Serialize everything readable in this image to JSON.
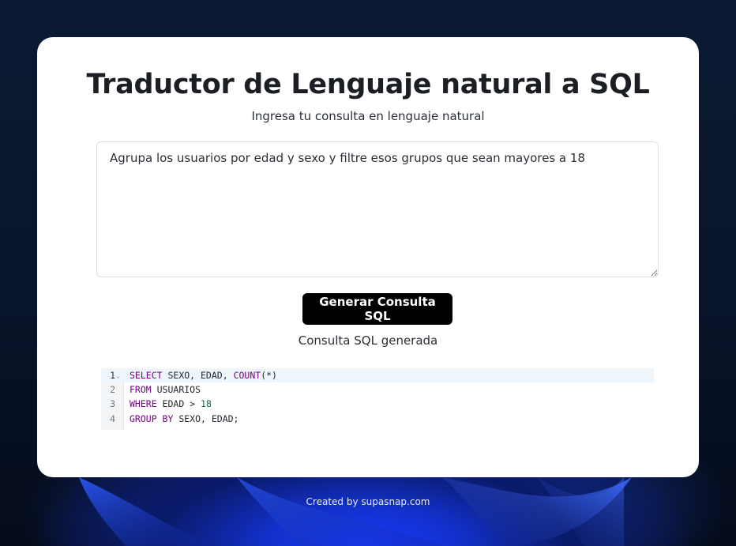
{
  "app": {
    "title": "Traductor de Lenguaje natural a SQL",
    "subtitle": "Ingresa tu consulta en lenguaje natural"
  },
  "query": {
    "value": "Agrupa los usuarios por edad y sexo y filtre esos grupos que sean mayores a 18"
  },
  "actions": {
    "generate_label": "Generar Consulta SQL"
  },
  "result": {
    "label": "Consulta SQL generada",
    "lines": [
      {
        "number": "1",
        "tokens": {
          "k1": "SELECT",
          "t1": " SEXO, EDAD, ",
          "f1": "COUNT",
          "t2": "(*)"
        }
      },
      {
        "number": "2",
        "tokens": {
          "k1": "FROM",
          "t1": " USUARIOS"
        }
      },
      {
        "number": "3",
        "tokens": {
          "k1": "WHERE",
          "t1": " EDAD > ",
          "n1": "18"
        }
      },
      {
        "number": "4",
        "tokens": {
          "k1": "GROUP BY",
          "t1": " SEXO, EDAD;"
        }
      }
    ]
  },
  "footer": {
    "credit": "Created by supasnap.com"
  },
  "colors": {
    "button_bg": "#000000",
    "keyword": "#770088",
    "number": "#116644",
    "active_line": "#eef6fc"
  }
}
